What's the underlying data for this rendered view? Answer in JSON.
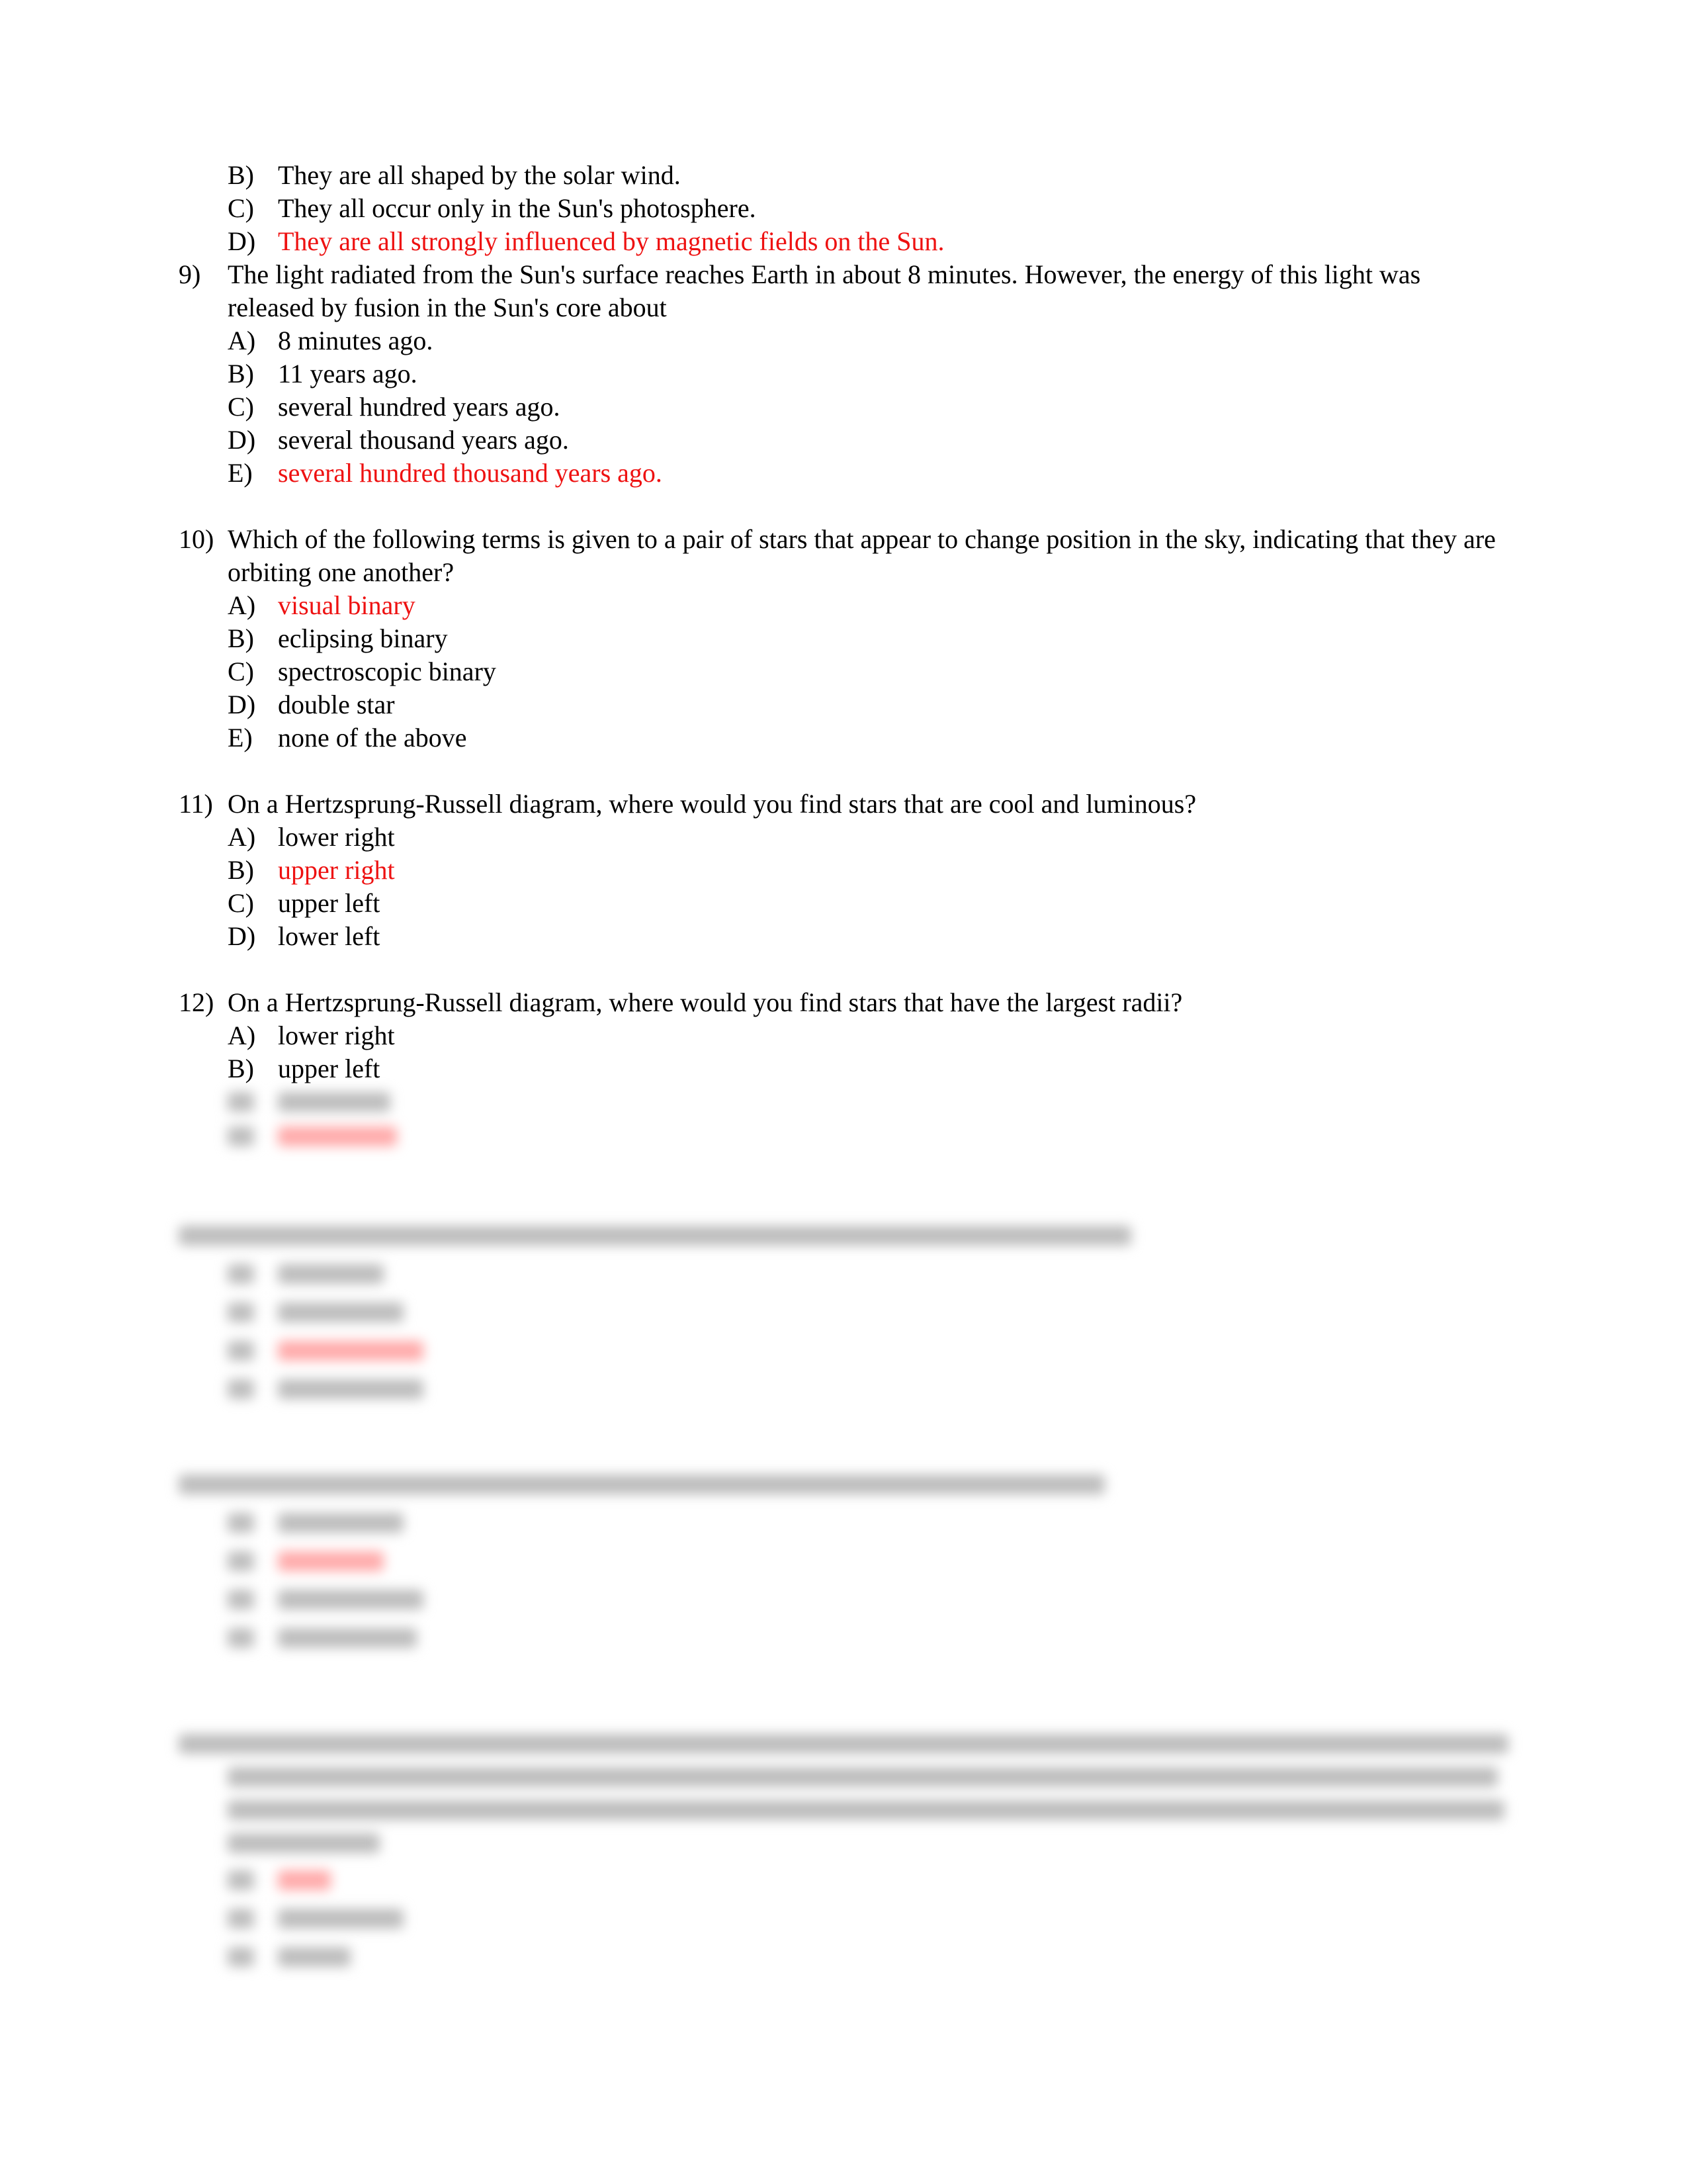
{
  "questions": [
    {
      "number": "",
      "prompt": "",
      "options": [
        {
          "letter": "B)",
          "text": "They are all shaped by the solar wind.",
          "correct": false
        },
        {
          "letter": "C)",
          "text": "They all occur only in the Sun's photosphere.",
          "correct": false
        },
        {
          "letter": "D)",
          "text": "They are all strongly influenced by magnetic fields on the Sun.",
          "correct": true
        }
      ]
    },
    {
      "number": "9)",
      "prompt": "The light radiated from the Sun's surface reaches Earth in about 8 minutes. However, the energy of this light was released by fusion in the Sun's core about",
      "options": [
        {
          "letter": "A)",
          "text": "8 minutes ago.",
          "correct": false
        },
        {
          "letter": "B)",
          "text": "11 years ago.",
          "correct": false
        },
        {
          "letter": "C)",
          "text": "several hundred years ago.",
          "correct": false
        },
        {
          "letter": "D)",
          "text": "several thousand years ago.",
          "correct": false
        },
        {
          "letter": "E)",
          "text": "several hundred thousand years ago.",
          "correct": true
        }
      ]
    },
    {
      "number": "10)",
      "prompt": "Which of the following terms is given to a pair of stars that appear to change position in the sky, indicating that they are orbiting one another?",
      "options": [
        {
          "letter": "A)",
          "text": "visual binary",
          "correct": true
        },
        {
          "letter": "B)",
          "text": "eclipsing binary",
          "correct": false
        },
        {
          "letter": "C)",
          "text": "spectroscopic binary",
          "correct": false
        },
        {
          "letter": "D)",
          "text": "double star",
          "correct": false
        },
        {
          "letter": "E)",
          "text": "none of the above",
          "correct": false
        }
      ]
    },
    {
      "number": "11)",
      "prompt": "On a Hertzsprung-Russell diagram, where would you find stars that are cool and luminous?",
      "options": [
        {
          "letter": "A)",
          "text": "lower right",
          "correct": false
        },
        {
          "letter": "B)",
          "text": "upper right",
          "correct": true
        },
        {
          "letter": "C)",
          "text": "upper left",
          "correct": false
        },
        {
          "letter": "D)",
          "text": "lower left",
          "correct": false
        }
      ]
    },
    {
      "number": "12)",
      "prompt": "On a Hertzsprung-Russell diagram, where would you find stars that have the largest radii?",
      "options": [
        {
          "letter": "A)",
          "text": "lower right",
          "correct": false
        },
        {
          "letter": "B)",
          "text": "upper left",
          "correct": false
        }
      ]
    }
  ],
  "blurred_region": {
    "note": "remaining content is blurred/obscured",
    "colors": {
      "text": "#bdbdbd",
      "answer": "#ffaaaa"
    }
  }
}
